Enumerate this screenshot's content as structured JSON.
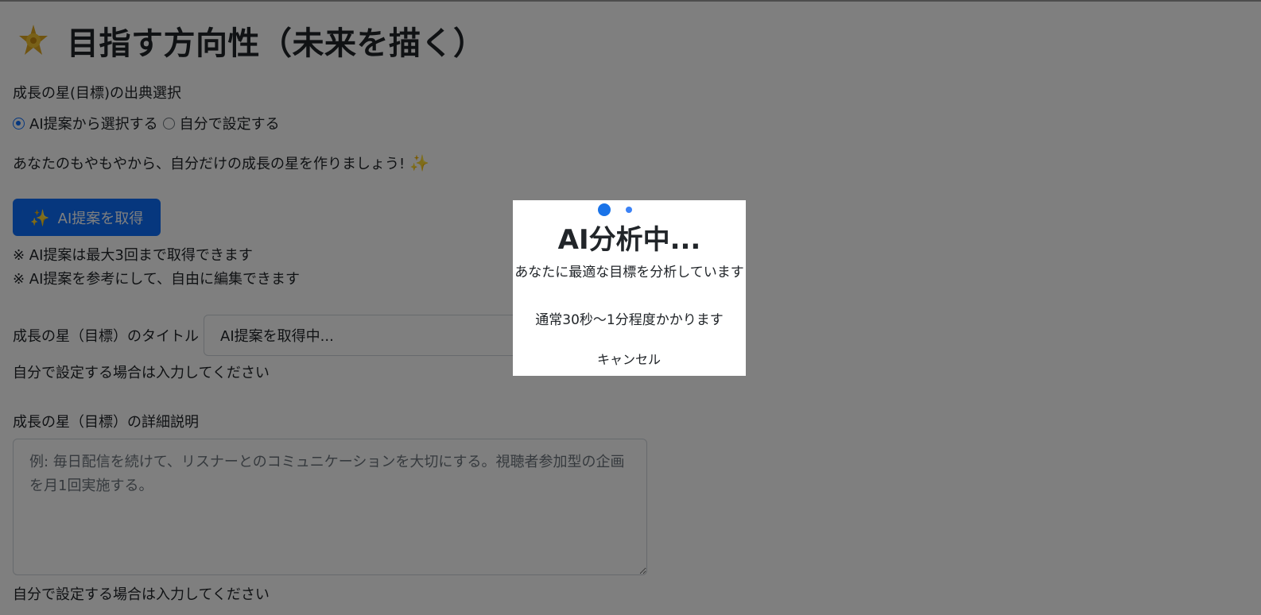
{
  "header": {
    "icon": "star-icon",
    "title": "目指す方向性（未来を描く）"
  },
  "source": {
    "label": "成長の星(目標)の出典選択",
    "options": [
      {
        "label": "AI提案から選択する",
        "checked": true
      },
      {
        "label": "自分で設定する",
        "checked": false
      }
    ]
  },
  "intro": {
    "text": "あなたのもやもやから、自分だけの成長の星を作りましょう!",
    "icon": "sparkles-icon"
  },
  "ai_button": {
    "icon": "sparkles-icon",
    "label": "AI提案を取得",
    "color": "#0d6efd"
  },
  "notes": [
    "※ AI提案は最大3回まで取得できます",
    "※ AI提案を参考にして、自由に編集できます"
  ],
  "title_field": {
    "label": "成長の星（目標）のタイトル",
    "value": "AI提案を取得中...",
    "hint": "自分で設定する場合は入力してください"
  },
  "detail_field": {
    "label": "成長の星（目標）の詳細説明",
    "placeholder": "例: 毎日配信を続けて、リスナーとのコミュニケーションを大切にする。視聴者参加型の企画を月1回実施する。",
    "hint": "自分で設定する場合は入力してください"
  },
  "modal": {
    "title": "AI分析中...",
    "description": "あなたに最適な目標を分析しています",
    "time_note": "通常30秒〜1分程度かかります",
    "cancel_label": "キャンセル",
    "loader_color": "#1a73e8"
  },
  "overlay_color": "rgba(0,0,0,0.5)"
}
